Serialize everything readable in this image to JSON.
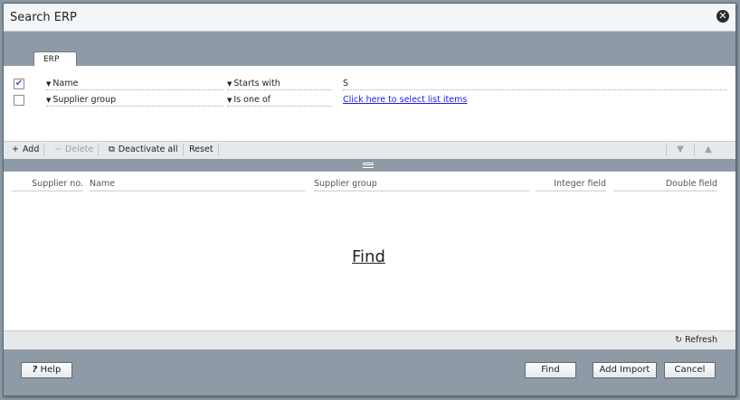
{
  "window": {
    "title": "Search ERP",
    "close_label": "✕"
  },
  "tabs": [
    {
      "label": "ERP"
    }
  ],
  "criteria": [
    {
      "checked": true,
      "field": "Name",
      "operator": "Starts with",
      "value": "S",
      "value_is_link": false
    },
    {
      "checked": false,
      "field": "Supplier group",
      "operator": "Is one of",
      "value": "Click here to select list items",
      "value_is_link": true
    }
  ],
  "toolbar": {
    "add_label": "Add",
    "delete_label": "Delete",
    "deactivate_all_label": "Deactivate all",
    "reset_label": "Reset"
  },
  "results": {
    "columns": [
      "Supplier no.",
      "Name",
      "Supplier group",
      "Integer field",
      "Double field"
    ],
    "find_link_label": "Find"
  },
  "status": {
    "refresh_label": "Refresh"
  },
  "footer": {
    "help_label": "Help",
    "find_label": "Find",
    "add_import_label": "Add Import",
    "cancel_label": "Cancel"
  },
  "icons": {
    "close": "close-icon",
    "add": "plus-icon",
    "delete": "minus-icon",
    "deactivate_all": "copy-icon",
    "move_down": "arrow-down-icon",
    "move_up": "arrow-up-icon",
    "refresh": "refresh-icon",
    "help": "question-icon"
  },
  "colors": {
    "accent": "#8e9ba6",
    "link": "#1a1aee"
  }
}
